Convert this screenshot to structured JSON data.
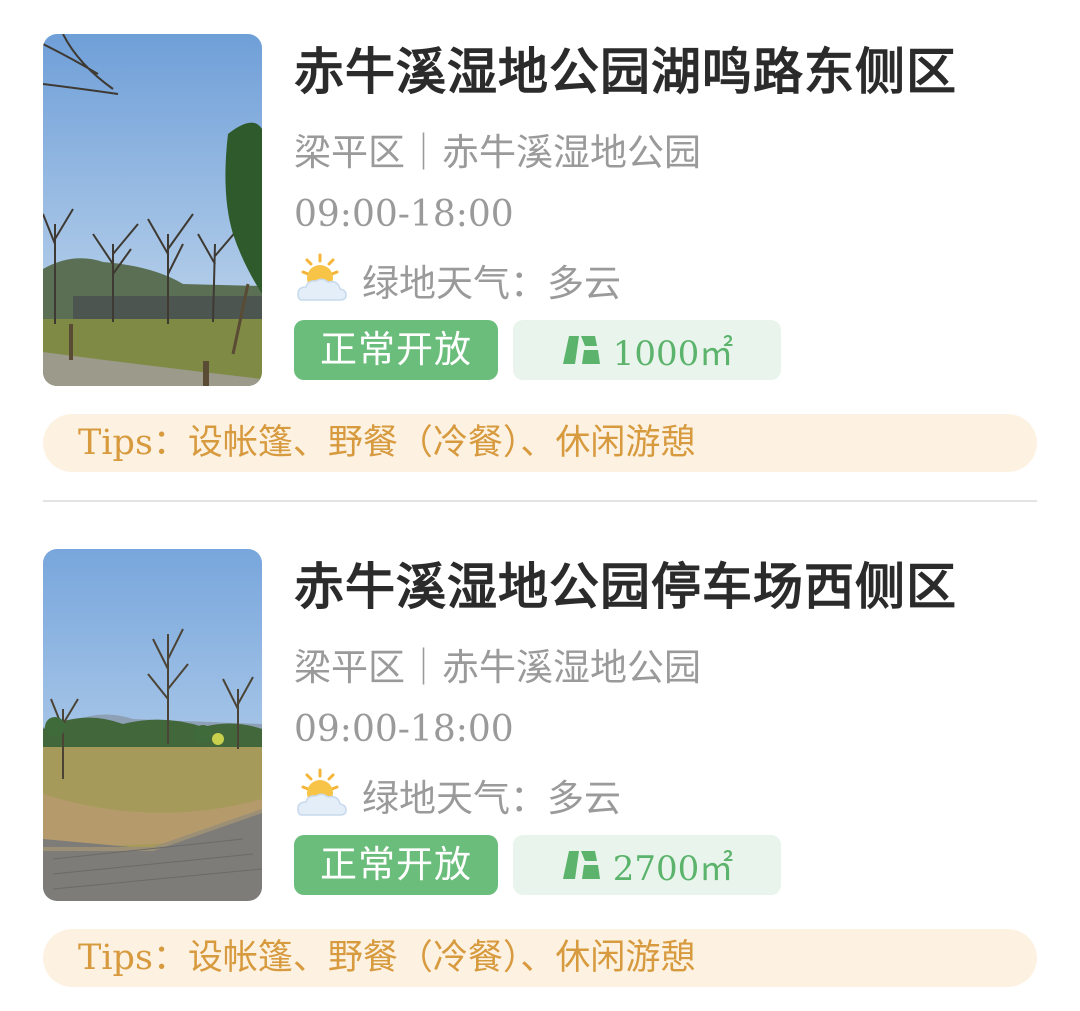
{
  "sites": [
    {
      "title": "赤牛溪湿地公园湖鸣路东侧区",
      "subtitle": "梁平区｜赤牛溪湿地公园",
      "hours": "09:00-18:00",
      "weather_icon": "partly-cloudy-icon",
      "weather_label": "绿地天气：",
      "weather_value": "多云",
      "status": "正常开放",
      "area_icon": "map-icon",
      "area": "1000㎡",
      "tips_label": "Tips：",
      "tips": "设帐篷、野餐（冷餐）、休闲游憩"
    },
    {
      "title": "赤牛溪湿地公园停车场西侧区",
      "subtitle": "梁平区｜赤牛溪湿地公园",
      "hours": "09:00-18:00",
      "weather_icon": "partly-cloudy-icon",
      "weather_label": "绿地天气：",
      "weather_value": "多云",
      "status": "正常开放",
      "area_icon": "map-icon",
      "area": "2700㎡",
      "tips_label": "Tips：",
      "tips": "设帐篷、野餐（冷餐）、休闲游憩"
    }
  ],
  "colors": {
    "title": "#2b2b2b",
    "secondary_text": "#9a9a9a",
    "status_green": "#6bbd7b",
    "area_bg": "#e9f5ec",
    "area_text": "#5cb36c",
    "tips_bg": "#fdf2e2",
    "tips_text": "#d79a3e"
  }
}
